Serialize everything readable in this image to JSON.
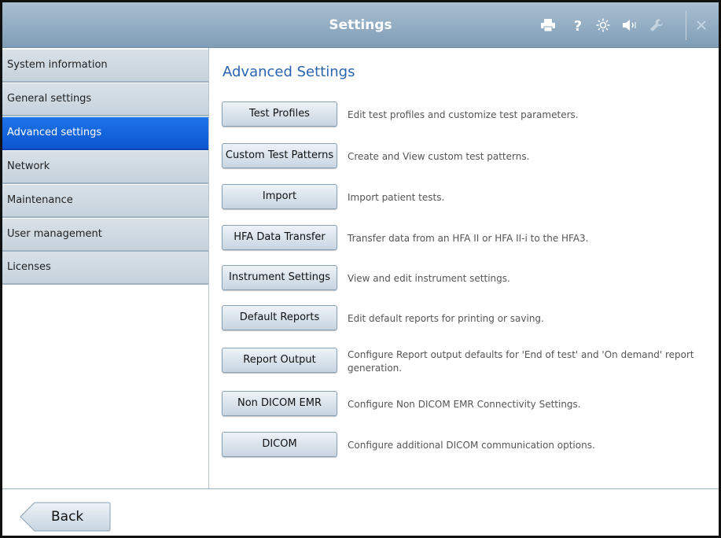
{
  "window": {
    "title": "Settings"
  },
  "toolbar": {
    "icons": [
      "printer-icon",
      "help-icon",
      "brightness-icon",
      "volume-icon",
      "wrench-icon",
      "close-icon"
    ]
  },
  "sidebar": {
    "items": [
      {
        "label": "System information",
        "active": false
      },
      {
        "label": "General settings",
        "active": false
      },
      {
        "label": "Advanced settings",
        "active": true
      },
      {
        "label": "Network",
        "active": false
      },
      {
        "label": "Maintenance",
        "active": false
      },
      {
        "label": "User management",
        "active": false
      },
      {
        "label": "Licenses",
        "active": false
      }
    ]
  },
  "main": {
    "heading": "Advanced Settings",
    "rows": [
      {
        "button": "Test Profiles",
        "description": "Edit test profiles and customize test parameters."
      },
      {
        "button": "Custom Test Patterns",
        "description": "Create and View custom test patterns."
      },
      {
        "button": "Import",
        "description": "Import patient tests."
      },
      {
        "button": "HFA Data Transfer",
        "description": "Transfer data from an HFA II or HFA II-i to the HFA3."
      },
      {
        "button": "Instrument Settings",
        "description": "View and edit instrument settings."
      },
      {
        "button": "Default Reports",
        "description": "Edit default reports for printing or saving."
      },
      {
        "button": "Report Output",
        "description": "Configure Report output defaults for 'End of test' and 'On demand' report generation."
      },
      {
        "button": "Non DICOM EMR",
        "description": "Configure Non DICOM EMR Connectivity Settings."
      },
      {
        "button": "DICOM",
        "description": "Configure additional DICOM communication options."
      }
    ]
  },
  "footer": {
    "back_label": "Back"
  },
  "colors": {
    "titlebar": "#8fa9bf",
    "accent": "#0b56cf",
    "heading": "#2a63b0"
  }
}
